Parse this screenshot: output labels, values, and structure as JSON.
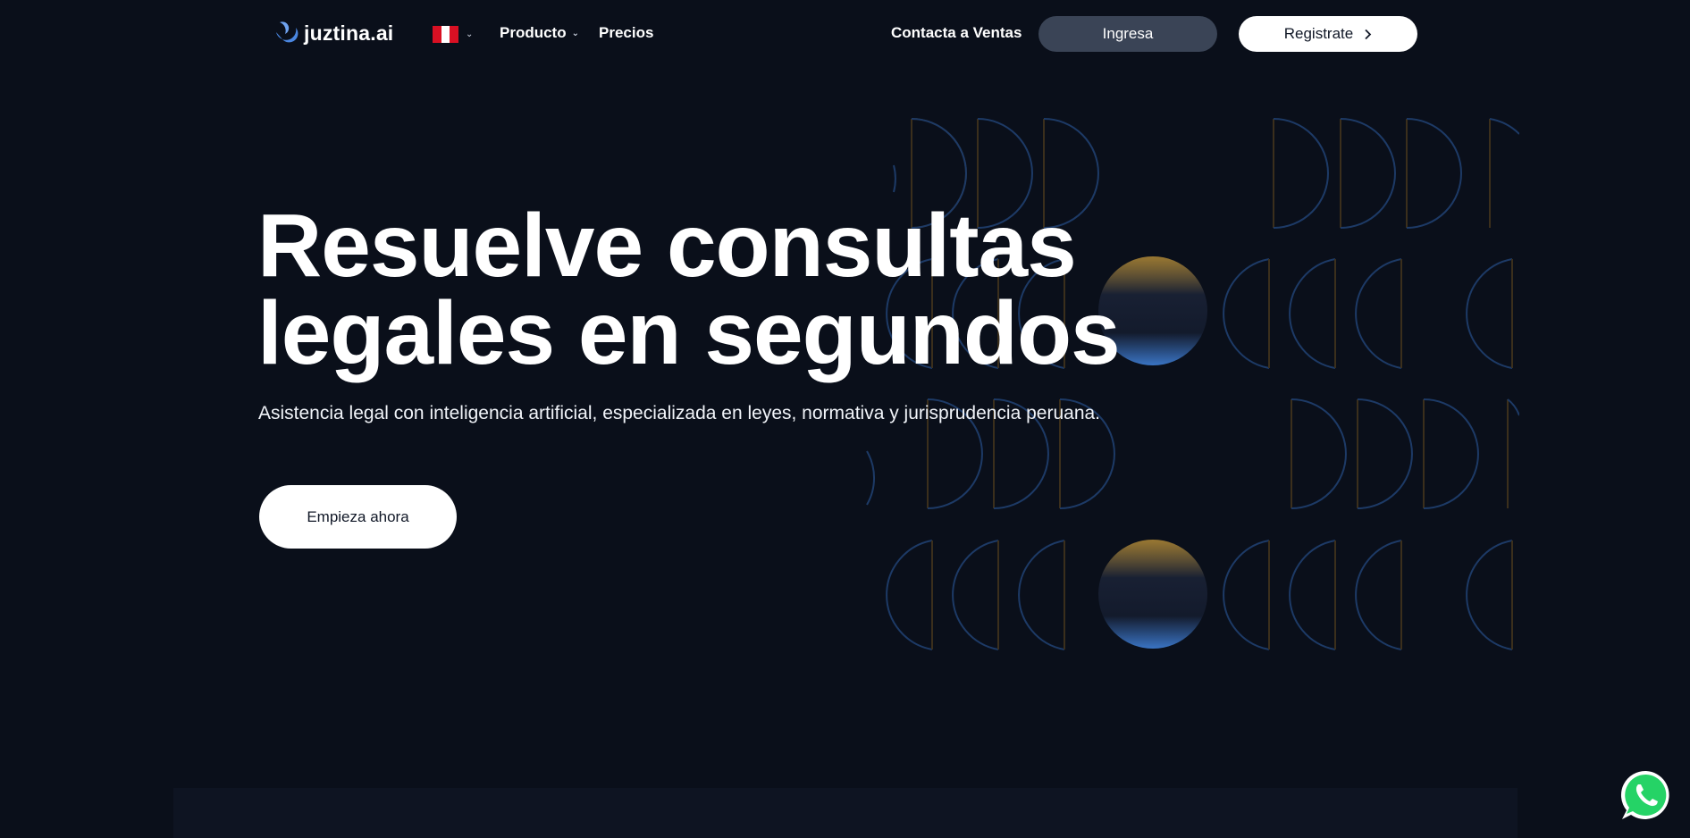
{
  "brand": {
    "name": "juztina.ai",
    "logo_icon": "crescent-logo-icon"
  },
  "nav": {
    "country_flag": "peru-flag-icon",
    "producto": "Producto",
    "precios": "Precios",
    "contacta": "Contacta a Ventas",
    "ingresa": "Ingresa",
    "registrate": "Registrate"
  },
  "hero": {
    "title_line1": "Resuelve consultas",
    "title_line2": "legales en segundos",
    "subtitle": "Asistencia legal con inteligencia artificial, especializada en leyes, normativa y jurisprudencia peruana.",
    "cta": "Empieza ahora"
  },
  "floating": {
    "whatsapp_icon": "whatsapp-icon"
  },
  "colors": {
    "background": "#0a0f1a",
    "accent_blue": "#3f7fd6",
    "accent_gold": "#c89a3a",
    "button_dark": "#3a4456",
    "whatsapp_green": "#25d366"
  }
}
